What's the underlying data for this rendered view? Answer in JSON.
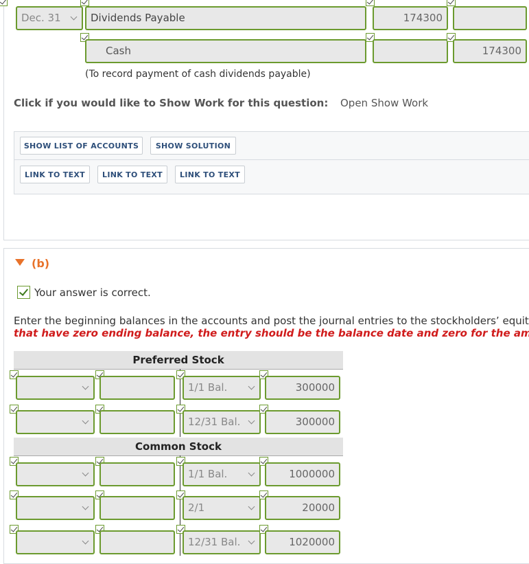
{
  "journal": {
    "row1": {
      "date": "Dec. 31",
      "account": "Dividends Payable",
      "debit": "174300",
      "credit": ""
    },
    "row2": {
      "account": "Cash",
      "debit": "",
      "credit": "174300"
    },
    "explanation": "(To record payment of cash dividends payable)"
  },
  "show_work": {
    "prompt": "Click if you would like to Show Work for this question:",
    "link": "Open Show Work"
  },
  "buttons": {
    "show_list": "SHOW LIST OF ACCOUNTS",
    "show_solution": "SHOW SOLUTION",
    "link1": "LINK TO TEXT",
    "link2": "LINK TO TEXT",
    "link3": "LINK TO TEXT"
  },
  "part_b": {
    "label": "(b)",
    "status": "Your answer is correct.",
    "instruction": "Enter the beginning balances in the accounts and post the journal entries to the stockholders’ equit",
    "instruction_red": "that have zero ending balance, the entry should be the balance date and zero for the amo"
  },
  "preferred_stock": {
    "title": "Preferred Stock",
    "rows": [
      {
        "date": "1/1 Bal.",
        "amount": "300000"
      },
      {
        "date": "12/31 Bal.",
        "amount": "300000"
      }
    ]
  },
  "common_stock": {
    "title": "Common Stock",
    "rows": [
      {
        "date": "1/1 Bal.",
        "amount": "1000000"
      },
      {
        "date": "2/1",
        "amount": "20000"
      },
      {
        "date": "12/31 Bal.",
        "amount": "1020000"
      }
    ]
  },
  "colors": {
    "field_border": "#6b9a2e",
    "accent_orange": "#e8722a",
    "error_red": "#d01c1c",
    "button_text": "#2e4f7a"
  }
}
